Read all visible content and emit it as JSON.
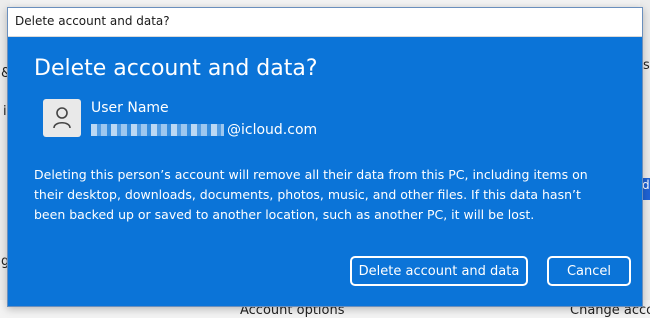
{
  "background": {
    "left_glyphs": [
      "&",
      "i",
      "g"
    ],
    "right_glyph_top": "s",
    "right_accent_glyph": "d",
    "bottom_labels": {
      "account_options": "Account options",
      "change_account": "Change accou"
    }
  },
  "dialog": {
    "window_title": "Delete account and data?",
    "heading": "Delete account and data?",
    "user": {
      "name": "User Name",
      "email_domain": "@icloud.com",
      "avatar_icon": "person-icon"
    },
    "message": "Deleting this person’s account will remove all their data from this PC, including items on their desktop, downloads, documents, photos, music, and other files. If this data hasn’t been backed up or saved to another location, such as another PC, it will be lost.",
    "buttons": {
      "delete_label": "Delete account and data",
      "cancel_label": "Cancel"
    },
    "accent_color": "#0b74d8"
  }
}
